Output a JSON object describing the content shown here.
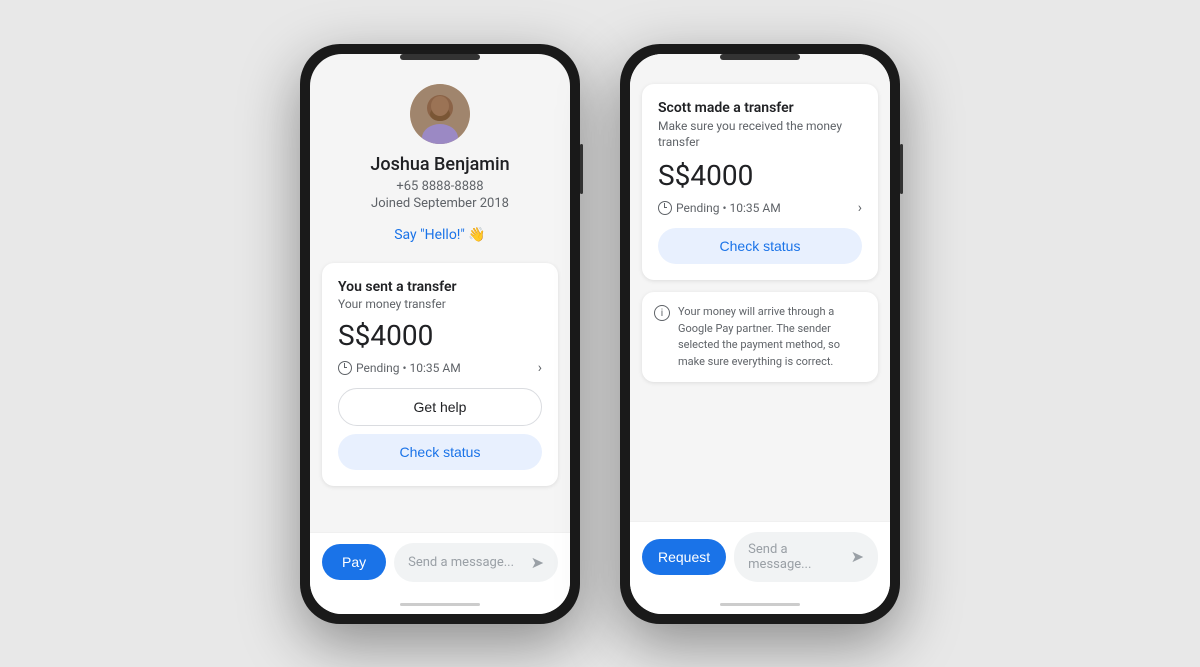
{
  "page": {
    "background_color": "#e8e8e8"
  },
  "phone1": {
    "user": {
      "name": "Joshua Benjamin",
      "phone": "+65 8888-8888",
      "joined": "Joined September 2018",
      "say_hello": "Say \"Hello!\" 👋"
    },
    "transfer_card": {
      "title": "You sent a transfer",
      "subtitle": "Your money transfer",
      "amount": "S$4000",
      "status": "Pending • 10:35 AM",
      "btn_help": "Get help",
      "btn_check": "Check status"
    },
    "bottom": {
      "btn_pay": "Pay",
      "message_placeholder": "Send a message..."
    }
  },
  "phone2": {
    "received_card": {
      "title": "Scott made a transfer",
      "subtitle": "Make sure you received the money transfer",
      "amount": "S$4000",
      "status": "Pending • 10:35 AM",
      "btn_check": "Check status"
    },
    "info_note": "Your money will arrive through a Google Pay partner. The sender selected the payment method, so make sure everything is correct.",
    "bottom": {
      "btn_request": "Request",
      "message_placeholder": "Send a message..."
    }
  }
}
